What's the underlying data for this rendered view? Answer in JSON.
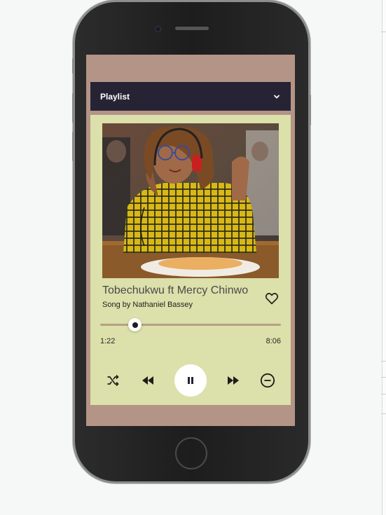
{
  "header": {
    "title": "Playlist"
  },
  "song": {
    "title": "Tobechukwu ft Mercy Chinwo",
    "subtitle": "Song by Nathaniel Bassey",
    "art_icon": "album-cover-photo"
  },
  "player": {
    "current_time": "1:22",
    "total_time": "8:06",
    "progress": 0.19
  },
  "icons": {
    "shuffle": "shuffle-icon",
    "rewind": "rewind-icon",
    "pause": "pause-icon",
    "forward": "fast-forward-icon",
    "remove": "remove-circle-icon",
    "heart": "heart-outline-icon",
    "chevron": "chevron-down-icon"
  },
  "colors": {
    "screen_bg": "#b49486",
    "header_bg": "#262335",
    "card_bg": "#dce0aa",
    "track": "#b59f86"
  }
}
